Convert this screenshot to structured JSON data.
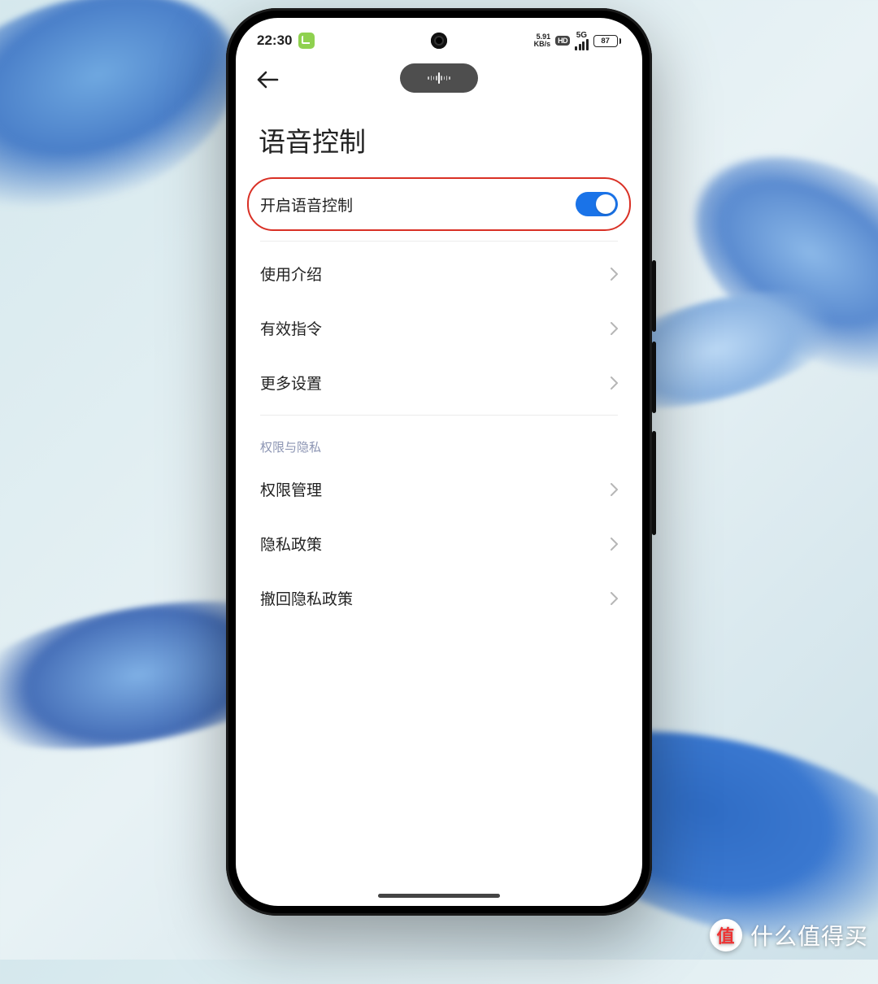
{
  "status": {
    "time": "22:30",
    "net_speed_value": "5.91",
    "net_speed_unit": "KB/s",
    "hd": "HD",
    "network": "5G",
    "battery": "87"
  },
  "page": {
    "title": "语音控制"
  },
  "toggle_row": {
    "label": "开启语音控制",
    "enabled": true
  },
  "rows_group1": [
    {
      "label": "使用介绍"
    },
    {
      "label": "有效指令"
    },
    {
      "label": "更多设置"
    }
  ],
  "section2_header": "权限与隐私",
  "rows_group2": [
    {
      "label": "权限管理"
    },
    {
      "label": "隐私政策"
    },
    {
      "label": "撤回隐私政策"
    }
  ],
  "watermark": {
    "badge": "值",
    "text": "什么值得买"
  }
}
